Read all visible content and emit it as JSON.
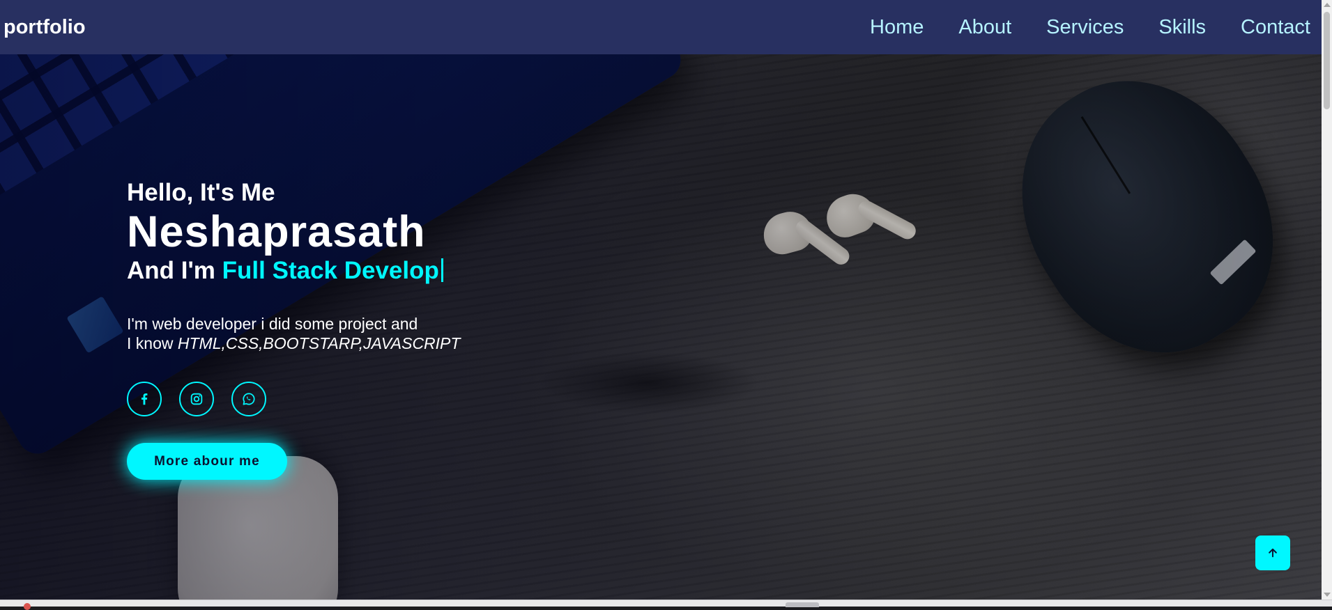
{
  "navbar": {
    "logo": "portfolio",
    "links": [
      {
        "label": "Home"
      },
      {
        "label": "About"
      },
      {
        "label": "Services"
      },
      {
        "label": "Skills"
      },
      {
        "label": "Contact"
      }
    ]
  },
  "hero": {
    "greeting": "Hello, It's Me",
    "name": "Neshaprasath",
    "role_prefix": "And I'm",
    "role_typed": "Full Stack Develop",
    "description_line1": "I'm web developer i did some project and",
    "description_line2_prefix": "I know",
    "description_skills": "HTML,CSS,BOOTSTARP,JAVASCRIPT",
    "social_icons": [
      "facebook-icon",
      "instagram-icon",
      "whatsapp-icon"
    ],
    "cta_label": "More abour me"
  },
  "colors": {
    "navbar_bg": "#283061",
    "accent": "#00f7ff",
    "nav_link": "#b6f3ff",
    "text": "#ffffff"
  },
  "icons": {
    "back_to_top": "arrow-up-icon"
  }
}
